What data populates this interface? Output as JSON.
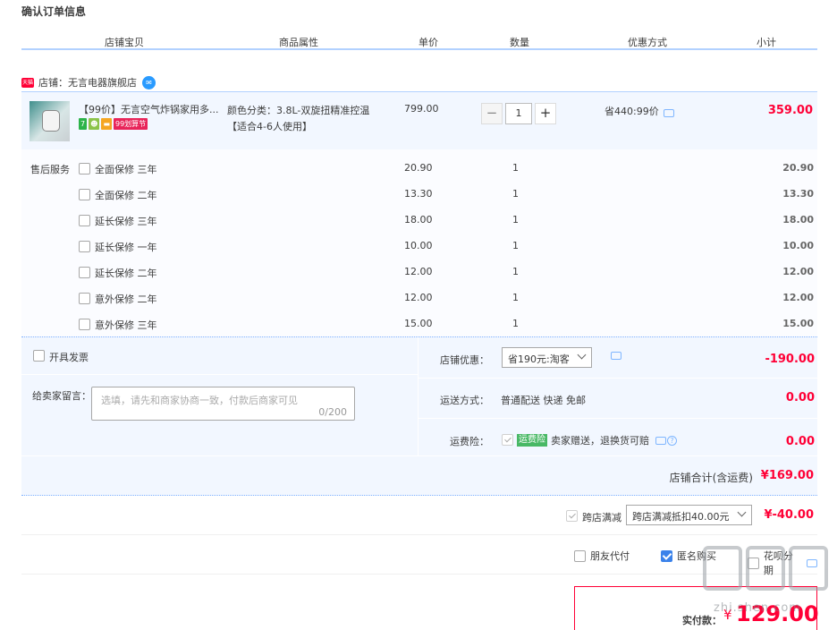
{
  "page_title": "确认订单信息",
  "columns": [
    "店铺宝贝",
    "商品属性",
    "单价",
    "数量",
    "优惠方式",
    "小计"
  ],
  "shop": {
    "tag": "天猫",
    "name": "店铺：无言电器旗舰店",
    "chat_icon": "wangwang-icon"
  },
  "item": {
    "title": "【99价】无言空气炸锅家用多...",
    "badges": [
      {
        "text": "7",
        "color": "#2cb34a"
      },
      {
        "text": "☻",
        "color": "#8bc34a"
      },
      {
        "text": "▬",
        "color": "#f5a623"
      },
      {
        "text": "99划算节",
        "color": "#e8255a"
      }
    ],
    "attr_line1": "颜色分类：3.8L-双旋扭精准控温",
    "attr_line2": "【适合4-6人使用】",
    "price": "799.00",
    "quantity": "1",
    "minus": "−",
    "plus": "+",
    "discount": "省440:99价",
    "subtotal": "359.00"
  },
  "service_label": "售后服务",
  "services": [
    {
      "name": "全面保修 三年",
      "price": "20.90",
      "qty": "1",
      "total": "20.90"
    },
    {
      "name": "全面保修 二年",
      "price": "13.30",
      "qty": "1",
      "total": "13.30"
    },
    {
      "name": "延长保修 三年",
      "price": "18.00",
      "qty": "1",
      "total": "18.00"
    },
    {
      "name": "延长保修 一年",
      "price": "10.00",
      "qty": "1",
      "total": "10.00"
    },
    {
      "name": "延长保修 二年",
      "price": "12.00",
      "qty": "1",
      "total": "12.00"
    },
    {
      "name": "意外保修 二年",
      "price": "12.00",
      "qty": "1",
      "total": "12.00"
    },
    {
      "name": "意外保修 三年",
      "price": "15.00",
      "qty": "1",
      "total": "15.00"
    }
  ],
  "invoice_label": "开具发票",
  "note": {
    "label": "给卖家留言：",
    "placeholder": "选填，请先和商家协商一致，付款后商家可见",
    "count": "0/200"
  },
  "shop_discount": {
    "label": "店铺优惠：",
    "selected": "省190元:淘客",
    "amount": "-190.00"
  },
  "shipping": {
    "label": "运送方式：",
    "value": "普通配送 快递 免邮",
    "amount": "0.00"
  },
  "insurance": {
    "label": "运费险：",
    "tag": "运费险",
    "text": "卖家赠送，退换货可赔",
    "amount": "0.00",
    "help": "?"
  },
  "shop_total": {
    "label": "店铺合计(含运费)",
    "value": "¥169.00"
  },
  "cross_discount": {
    "label": "跨店满减",
    "selected": "跨店满减抵扣40.00元",
    "amount": "¥-40.00"
  },
  "options": [
    {
      "label": "朋友代付",
      "checked": false
    },
    {
      "label": "匿名购买",
      "checked": true
    },
    {
      "label": "花呗分期",
      "checked": false
    }
  ],
  "payment": {
    "label": "实付款：",
    "currency": "¥",
    "amount": "129.00"
  },
  "watermark": "zhi.shen.com"
}
